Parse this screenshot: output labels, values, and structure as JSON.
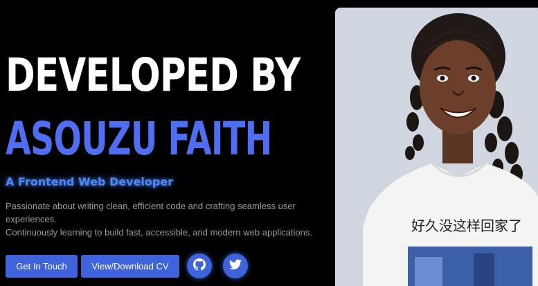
{
  "hero": {
    "line1": "DEVELOPED BY",
    "line2": "ASOUZU FAITH",
    "subtitle": "A Frontend Web Developer",
    "description": [
      "Passionate about writing clean, efficient code and crafting seamless user experiences.",
      "Continuously learning to build fast, accessible, and modern web applications."
    ]
  },
  "buttons": {
    "touch": "Get In Touch",
    "cv": "View/Download CV"
  },
  "social": [
    {
      "name": "GitHub",
      "icon": "github-icon"
    },
    {
      "name": "Twitter",
      "icon": "twitter-icon"
    }
  ],
  "photo": {
    "shirt_text": "好久没这样回家了"
  },
  "colors": {
    "background": "#000000",
    "accent": "#3e63dd",
    "name_blue": "#4f6ef2",
    "subtitle_glow": "#4f86f7",
    "muted_text": "#9a9ca3",
    "photo_bg": "#cfd6df"
  }
}
